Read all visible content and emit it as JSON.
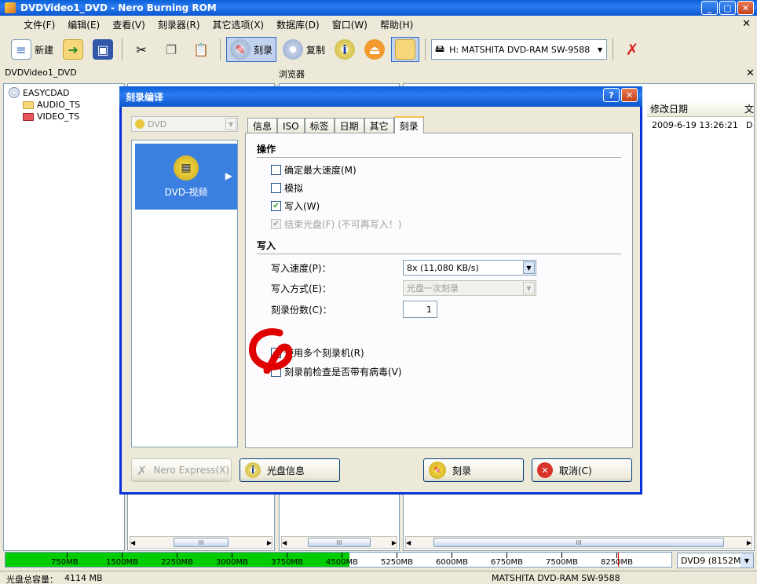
{
  "window": {
    "title": "DVDVideo1_DVD - Nero Burning ROM",
    "min": "_",
    "max": "▢",
    "close": "✕"
  },
  "menu": {
    "items": [
      "文件(F)",
      "编辑(E)",
      "查看(V)",
      "刻录器(R)",
      "其它选项(X)",
      "数据库(D)",
      "窗口(W)",
      "帮助(H)"
    ],
    "close": "✕"
  },
  "toolbar": {
    "new_label": "新建",
    "burn_label": "刻录",
    "copy_label": "复制",
    "drive": "H: MATSHITA DVD-RAM SW-9588"
  },
  "panels": {
    "left_title": "DVDVideo1_DVD",
    "browser_title": "浏览器",
    "browser_close": "✕",
    "tree": {
      "root": "EASYCDAD",
      "items": [
        "AUDIO_TS",
        "VIDEO_TS"
      ]
    },
    "right_cols": {
      "modified": "修改日期",
      "type_short": "文"
    },
    "right_row": {
      "modified": "2009-6-19 13:26:21",
      "type_short": "D"
    },
    "scroll_thumb": "III"
  },
  "dialog": {
    "title": "刻录编译",
    "help_btn": "?",
    "close_btn": "✕",
    "disc_type": "DVD",
    "project_item": "DVD-视频",
    "tabs": [
      "信息",
      "ISO",
      "标签",
      "日期",
      "其它",
      "刻录"
    ],
    "active_tab": "刻录",
    "sections": {
      "actions": "操作",
      "write": "写入"
    },
    "actions": [
      {
        "label": "确定最大速度(M)",
        "checked": false,
        "disabled": false
      },
      {
        "label": "模拟",
        "checked": false,
        "disabled": false
      },
      {
        "label": "写入(W)",
        "checked": true,
        "disabled": false
      },
      {
        "label": "结束光盘(F) (不可再写入！)",
        "checked": true,
        "disabled": true
      }
    ],
    "write": {
      "speed_label": "写入速度(P)：",
      "speed_value": "8x (11,080 KB/s)",
      "method_label": "写入方式(E)：",
      "method_value": "光盘一次刻录",
      "copies_label": "刻录份数(C)：",
      "copies_value": "1"
    },
    "options": [
      {
        "label": "使用多个刻录机(R)",
        "checked": true
      },
      {
        "label": "刻录前检查是否带有病毒(V)",
        "checked": false
      }
    ],
    "buttons": {
      "nero_express": "Nero Express(X)",
      "disc_info": "光盘信息",
      "burn": "刻录",
      "cancel": "取消(C)"
    }
  },
  "capacity": {
    "ticks": [
      "750MB",
      "1500MB",
      "2250MB",
      "3000MB",
      "3750MB",
      "4500MB",
      "5250MB",
      "6000MB",
      "6750MB",
      "7500MB",
      "8250MB"
    ],
    "used_mb": 4114,
    "disc_type": "DVD9 (8152MB)"
  },
  "status": {
    "total_label": "光盘总容量：",
    "total_value": "4114 MB",
    "drive": "MATSHITA DVD-RAM SW-9588"
  },
  "colors": {
    "title_bar": "#0a5fd8",
    "capacity_fill": "#00cc00",
    "annotation": "#e00000"
  }
}
